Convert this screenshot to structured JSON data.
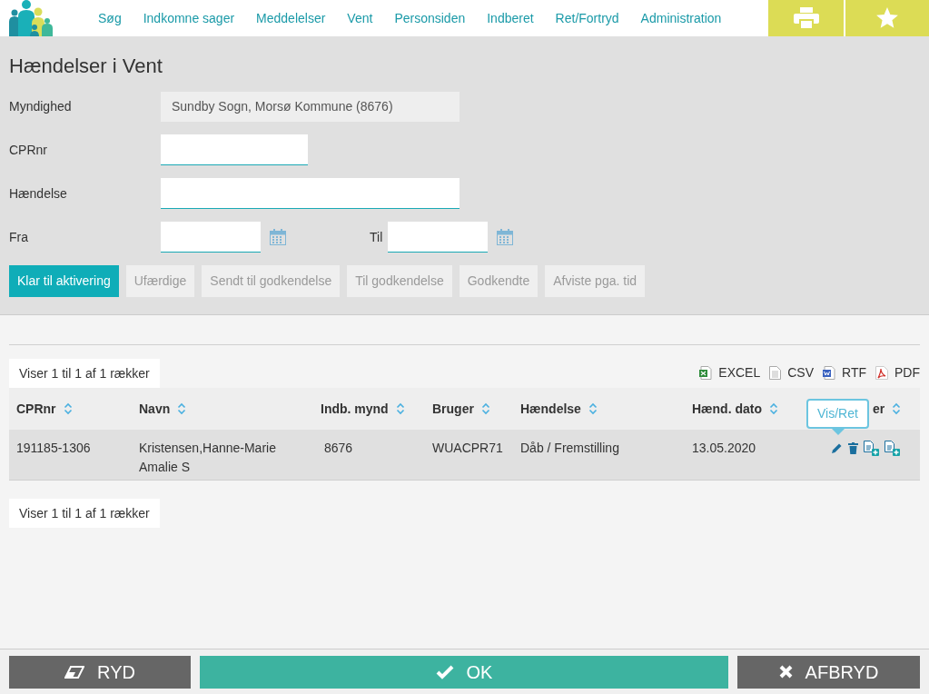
{
  "nav": {
    "items": [
      "Søg",
      "Indkomne sager",
      "Meddelelser",
      "Vent",
      "Personsiden",
      "Indberet",
      "Ret/Fortryd",
      "Administration"
    ]
  },
  "page_title": "Hændelser i Vent",
  "form": {
    "myndighed": {
      "label": "Myndighed",
      "value": "Sundby Sogn, Morsø Kommune (8676)"
    },
    "cprnr": {
      "label": "CPRnr"
    },
    "haendelse": {
      "label": "Hændelse"
    },
    "fra": {
      "label": "Fra"
    },
    "til": {
      "label": "Til"
    }
  },
  "tabs": [
    {
      "label": "Klar til aktivering",
      "selected": true
    },
    {
      "label": "Ufærdige",
      "selected": false
    },
    {
      "label": "Sendt til godkendelse",
      "selected": false
    },
    {
      "label": "Til godkendelse",
      "selected": false
    },
    {
      "label": "Godkendte",
      "selected": false
    },
    {
      "label": "Afviste pga. tid",
      "selected": false
    }
  ],
  "table_info_top": "Viser 1 til 1 af 1 rækker",
  "exports": [
    {
      "kind": "excel",
      "label": "EXCEL"
    },
    {
      "kind": "csv",
      "label": "CSV"
    },
    {
      "kind": "rtf",
      "label": "RTF"
    },
    {
      "kind": "pdf",
      "label": "PDF"
    }
  ],
  "table": {
    "columns": [
      "CPRnr",
      "Navn",
      "Indb. mynd",
      "Bruger",
      "Hændelse",
      "Hænd. dato",
      "er"
    ],
    "rows": [
      {
        "cells": [
          "191185-1306",
          "Kristensen,Hanne-Marie Amalie S",
          "8676",
          "WUACPR71",
          "Dåb / Fremstilling",
          "13.05.2020"
        ]
      }
    ]
  },
  "tooltip": "Vis/Ret",
  "table_info_bottom": "Viser 1 til 1 af 1 rækker",
  "footer": {
    "buttons": [
      {
        "kind": "clear",
        "label": "RYD"
      },
      {
        "kind": "ok",
        "label": "OK"
      },
      {
        "kind": "cancel",
        "label": "AFBRYD"
      }
    ]
  }
}
